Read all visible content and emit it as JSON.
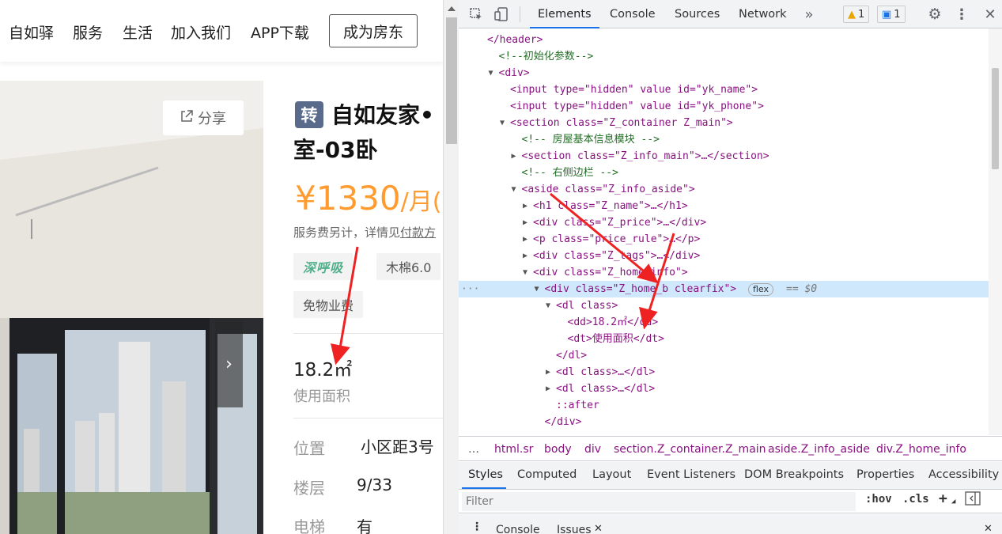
{
  "site": {
    "nav": [
      "自如驿",
      "服务",
      "生活",
      "加入我们",
      "APP下载"
    ],
    "nav_button": "成为房东",
    "share_label": "分享",
    "badge": "转",
    "title_line1": "自如友家•",
    "title_line2": "室-03卧",
    "price_num": "¥1330",
    "price_unit": "/月(",
    "rule_text": "服务费另计，详情见",
    "rule_link": "付款方",
    "tags": [
      "深呼吸",
      "木棉6.0",
      "免物业费"
    ],
    "area_value": "18.2㎡",
    "area_label": "使用面积",
    "rows": [
      {
        "label": "位置",
        "value": "小区距3号"
      },
      {
        "label": "楼层",
        "value": "9/33"
      },
      {
        "label": "电梯",
        "value": "有"
      }
    ],
    "next_icon": "chevron-right-icon"
  },
  "devtools": {
    "tabs": [
      "Elements",
      "Console",
      "Sources",
      "Network"
    ],
    "warn_count": "1",
    "msg_count": "1",
    "tree": [
      {
        "t": "</header>",
        "indent": 0
      },
      {
        "t": "<!--初始化参数-->",
        "indent": 1
      },
      {
        "t": "<div>",
        "indent": 1
      },
      {
        "t": "<input type=\"hidden\" value id=\"yk_name\">",
        "indent": 2
      },
      {
        "t": "<input type=\"hidden\" value id=\"yk_phone\">",
        "indent": 2
      },
      {
        "t": "<section class=\"Z_container Z_main\">",
        "indent": 2
      },
      {
        "t": "<!-- 房屋基本信息模块 -->",
        "indent": 3
      },
      {
        "t": "<section class=\"Z_info_main\">…</section>",
        "indent": 3
      },
      {
        "t": "<!-- 右侧边栏 -->",
        "indent": 3
      },
      {
        "t": "<aside class=\"Z_info_aside\">",
        "indent": 3
      },
      {
        "t": "<h1 class=\"Z_name\">…</h1>",
        "indent": 4
      },
      {
        "t": "<div class=\"Z_price\">…</div>",
        "indent": 4
      },
      {
        "t": "<p class=\"price_rule\">…</p>",
        "indent": 4
      },
      {
        "t": "<div class=\"Z_tags\">…</div>",
        "indent": 4
      },
      {
        "t": "<div class=\"Z_home_info\">",
        "indent": 4
      },
      {
        "t": "<div class=\"Z_home_b clearfix\">",
        "indent": 5
      },
      {
        "t": "<dl class>",
        "indent": 6
      },
      {
        "t": "<dd>18.2㎡</dd>",
        "indent": 7
      },
      {
        "t": "<dt>使用面积</dt>",
        "indent": 7
      },
      {
        "t": "</dl>",
        "indent": 6
      },
      {
        "t": "<dl class>…</dl>",
        "indent": 6
      },
      {
        "t": "<dl class>…</dl>",
        "indent": 6
      },
      {
        "t": "::after",
        "indent": 6
      },
      {
        "t": "</div>",
        "indent": 5
      }
    ],
    "flex_badge": "flex",
    "dollar0": "== $0",
    "breadcrumbs": [
      "…",
      "html.sr",
      "body",
      "div",
      "section.Z_container.Z_main",
      "aside.Z_info_aside",
      "div.Z_home_info"
    ],
    "style_tabs": [
      "Styles",
      "Computed",
      "Layout",
      "Event Listeners",
      "DOM Breakpoints",
      "Properties",
      "Accessibility"
    ],
    "filter_placeholder": "Filter",
    "hov": ":hov",
    "cls": ".cls",
    "drawer_tabs": [
      "Console",
      "Issues"
    ]
  }
}
